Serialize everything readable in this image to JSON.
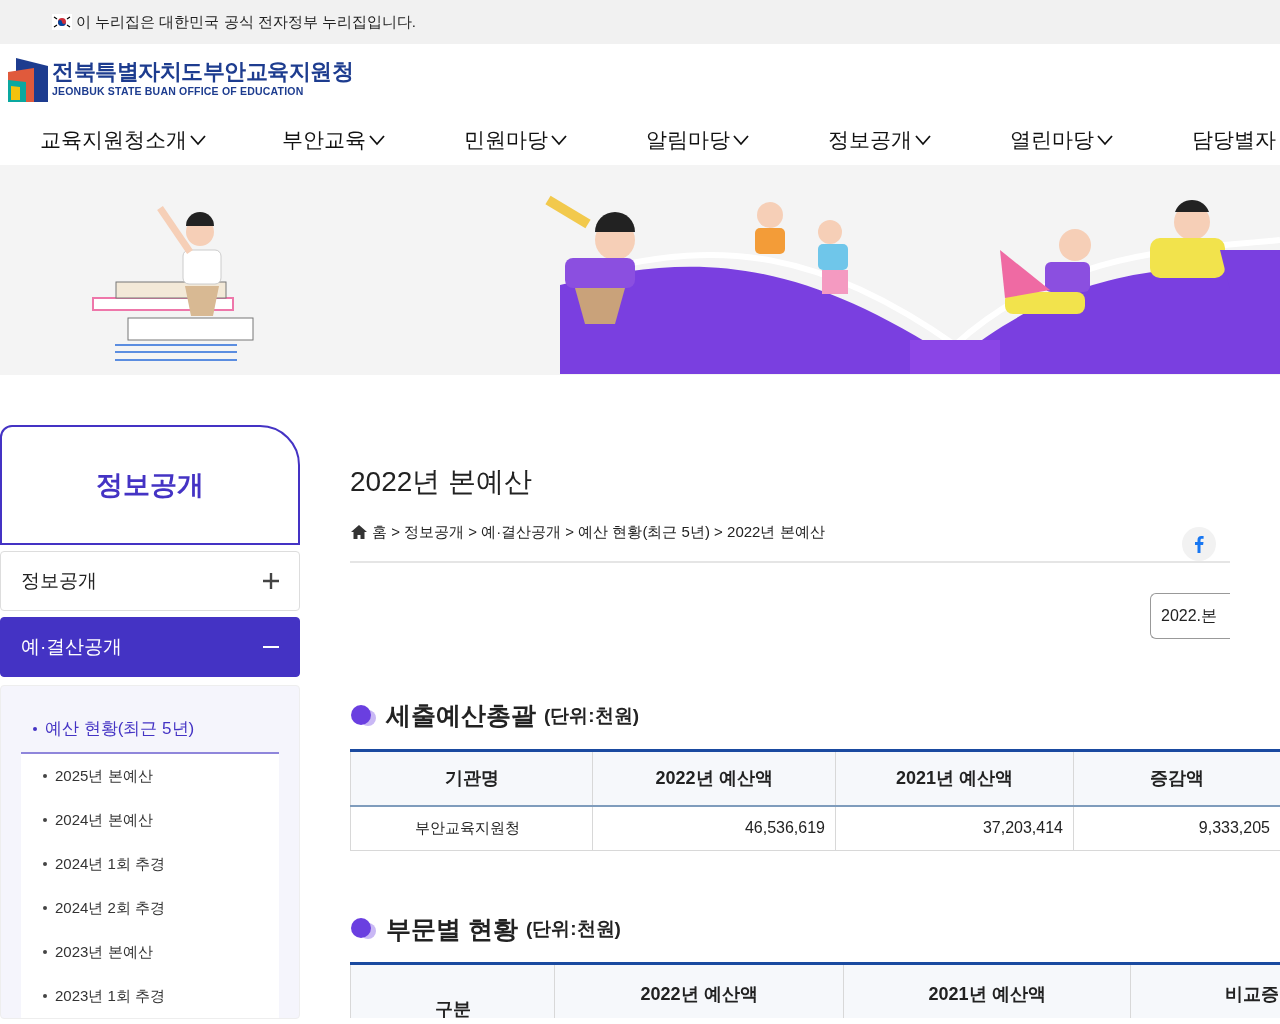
{
  "gov_banner": {
    "text": "이 누리집은 대한민국 공식 전자정부 누리집입니다."
  },
  "logo": {
    "name_ko": "전북특별자치도부안교육지원청",
    "name_en": "JEONBUK STATE BUAN OFFICE OF EDUCATION"
  },
  "nav": [
    {
      "label": "교육지원청소개",
      "dropdown": true
    },
    {
      "label": "부안교육",
      "dropdown": true
    },
    {
      "label": "민원마당",
      "dropdown": true
    },
    {
      "label": "알림마당",
      "dropdown": true
    },
    {
      "label": "정보공개",
      "dropdown": true
    },
    {
      "label": "열린마당",
      "dropdown": true
    },
    {
      "label": "담당별자"
    }
  ],
  "sidebar": {
    "title": "정보공개",
    "menu": [
      {
        "label": "정보공개",
        "expanded": false
      },
      {
        "label": "예·결산공개",
        "expanded": true,
        "children": [
          {
            "label": "예산 현황(최근 5년)",
            "selected": true,
            "children": [
              {
                "label": "2025년 본예산",
                "selected": false
              },
              {
                "label": "2024년 본예산",
                "selected": false
              },
              {
                "label": "2024년 1회 추경",
                "selected": false
              },
              {
                "label": "2024년 2회 추경",
                "selected": false
              },
              {
                "label": "2023년 본예산",
                "selected": false
              },
              {
                "label": "2023년 1회 추경",
                "selected": false
              }
            ]
          }
        ]
      }
    ]
  },
  "page_title": "2022년 본예산",
  "breadcrumb": "홈 > 정보공개 > 예·결산공개 > 예산 현황(최근 5년) > 2022년 본예산",
  "year_select": {
    "value": "2022.본"
  },
  "sections": [
    {
      "title": "세출예산총괄",
      "unit": "(단위:천원)",
      "columns": [
        "기관명",
        "2022년 예산액",
        "2021년 예산액",
        "증감액"
      ],
      "rows": [
        [
          "부안교육지원청",
          "46,536,619",
          "37,203,414",
          "9,333,205"
        ]
      ]
    },
    {
      "title": "부문별 현황",
      "unit": "(단위:천원)",
      "columns": [
        "구분",
        "2022년 예산액",
        "2021년 예산액",
        "비교증"
      ]
    }
  ]
}
